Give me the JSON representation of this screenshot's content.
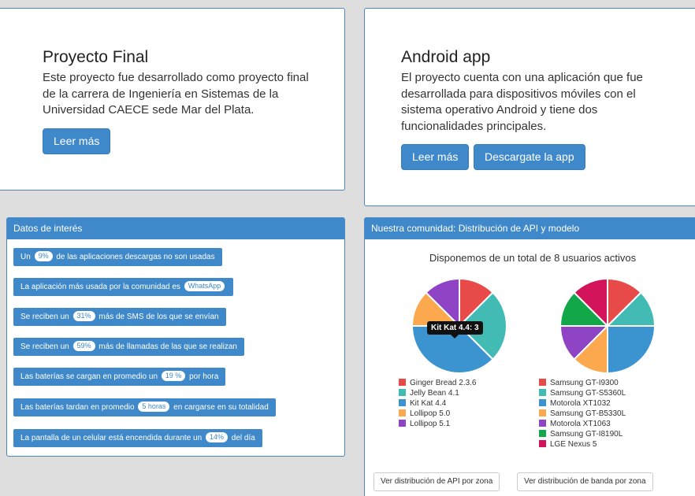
{
  "hero_left": {
    "title": "Proyecto Final",
    "text": "Este proyecto fue desarrollado como proyecto final de la carrera de Ingeniería en Sistemas de la Universidad CAECE sede Mar del Plata.",
    "button": "Leer más"
  },
  "hero_right": {
    "title": "Android app",
    "text": "El proyecto cuenta con una aplicación que fue desarrollada para dispositivos móviles con el sistema operativo Android y tiene dos funcionalidades principales.",
    "button_more": "Leer más",
    "button_download": "Descargate la app"
  },
  "facts": {
    "heading": "Datos de interés",
    "items": [
      {
        "before": "Un",
        "badge": "9%",
        "after": "de las aplicaciones descargas no son usadas"
      },
      {
        "before": "La aplicación más usada por la comunidad es",
        "badge": "WhatsApp",
        "after": ""
      },
      {
        "before": "Se reciben un",
        "badge": "31%",
        "after": "más de SMS de los que se envían"
      },
      {
        "before": "Se reciben un",
        "badge": "59%",
        "after": "más de llamadas de las que se realizan"
      },
      {
        "before": "Las baterías se cargan en promedio un",
        "badge": "19 %",
        "after": "por hora"
      },
      {
        "before": "Las baterías tardan en promedio",
        "badge": "5 horas",
        "after": "en cargarse en su totalidad"
      },
      {
        "before": "La pantalla de un celular está encendida durante un",
        "badge": "14%",
        "after": "del día"
      }
    ]
  },
  "community": {
    "heading": "Nuestra comunidad: Distribución de API y modelo",
    "summary": "Disponemos de un total de 8 usuarios activos",
    "tooltip": "Kit Kat 4.4: 3",
    "button_api": "Ver distribución de API por zona",
    "button_band": "Ver distribución de banda por zona"
  },
  "chart_data": [
    {
      "type": "pie",
      "labels": [
        "Ginger Bread 2.3.6",
        "Jelly Bean 4.1",
        "Kit Kat 4.4",
        "Lollipop 5.0",
        "Lollipop 5.1"
      ],
      "values": [
        1,
        2,
        3,
        1,
        1
      ],
      "colors": [
        "#e84a4a",
        "#42bbb5",
        "#3b93d0",
        "#fba84f",
        "#8e44c4"
      ]
    },
    {
      "type": "pie",
      "labels": [
        "Samsung GT-I9300",
        "Samsung GT-S5360L",
        "Motorola XT1032",
        "Samsung GT-B5330L",
        "Motorola XT1063",
        "Samsung GT-I8190L",
        "LGE Nexus 5"
      ],
      "values": [
        1,
        1,
        2,
        1,
        1,
        1,
        1
      ],
      "colors": [
        "#e84a4a",
        "#42bbb5",
        "#3b93d0",
        "#fba84f",
        "#8e44c4",
        "#12a84a",
        "#d4145a"
      ]
    }
  ]
}
